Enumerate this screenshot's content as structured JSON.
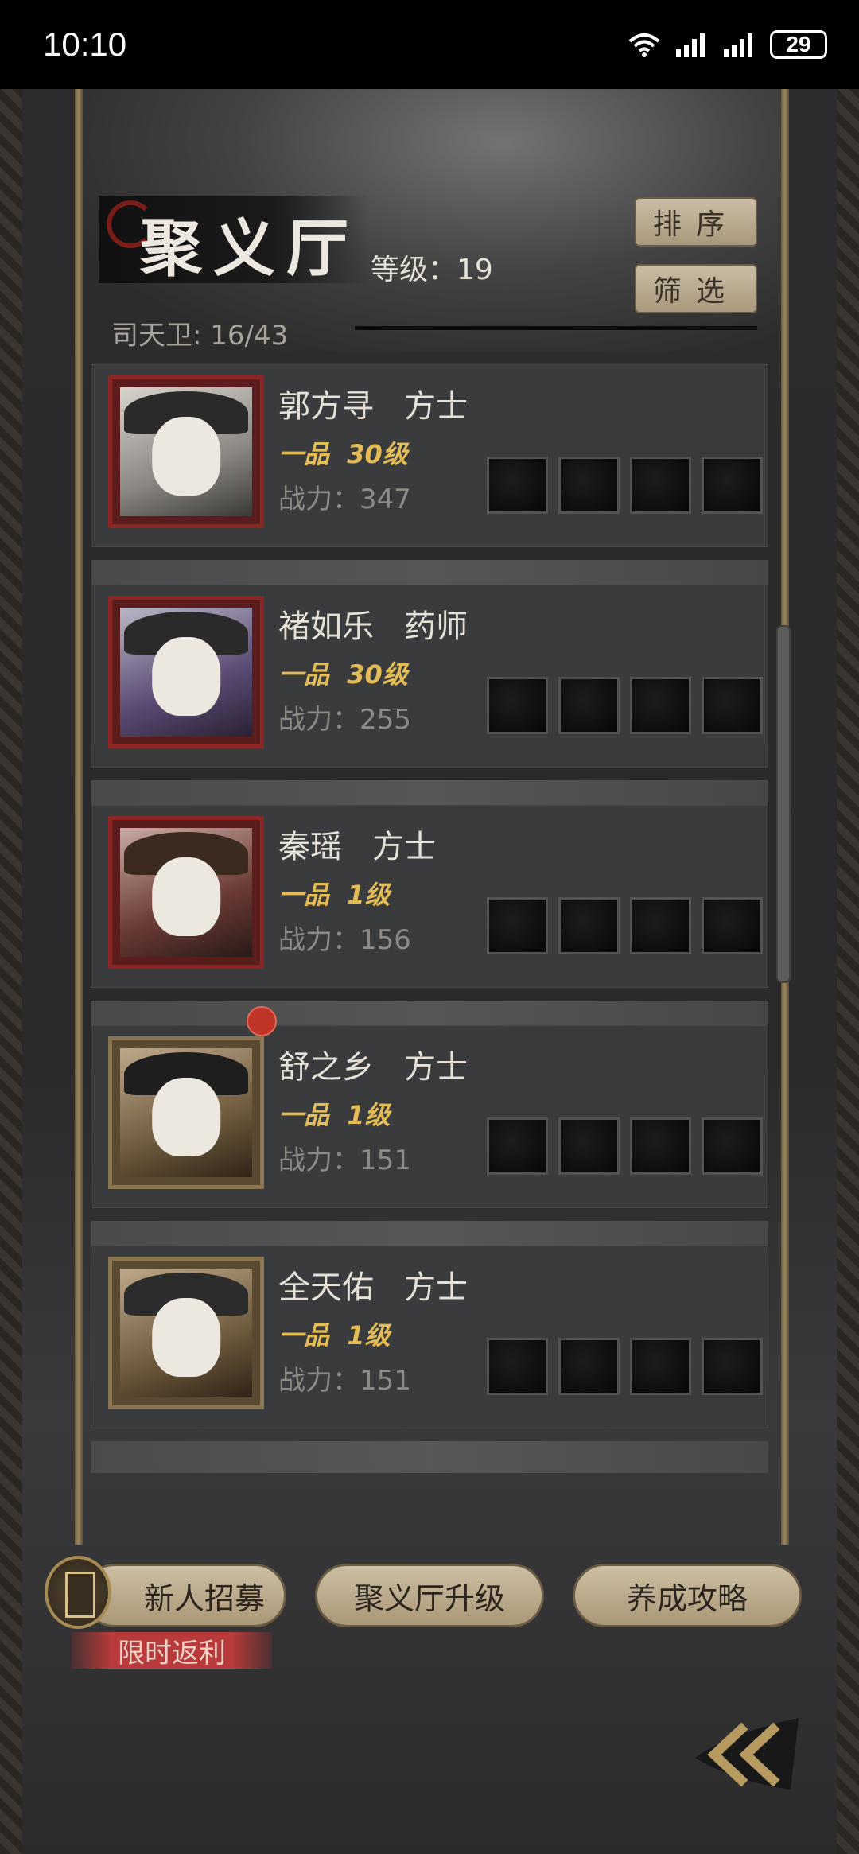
{
  "status_bar": {
    "time": "10:10",
    "battery": "29"
  },
  "header": {
    "title": "聚义厅",
    "level": "等级：19",
    "guards": "司天卫: 16/43",
    "sort_label": "排序",
    "filter_label": "筛选"
  },
  "members": [
    {
      "name": "郭方寻   方士",
      "grade": "一品  30级",
      "power": "战力：347",
      "frame": "red",
      "new": false
    },
    {
      "name": "褚如乐   药师",
      "grade": "一品  30级",
      "power": "战力：255",
      "frame": "red",
      "new": false
    },
    {
      "name": "秦瑶   方士",
      "grade": "一品  1级",
      "power": "战力：156",
      "frame": "red",
      "new": false
    },
    {
      "name": "舒之乡   方士",
      "grade": "一品  1级",
      "power": "战力：151",
      "frame": "gold",
      "new": true
    },
    {
      "name": "全天佑   方士",
      "grade": "一品  1级",
      "power": "战力：151",
      "frame": "gold",
      "new": false
    }
  ],
  "bottom": {
    "recruit_label": "新人招募",
    "upgrade_label": "聚义厅升级",
    "guide_label": "养成攻略",
    "promo_label": "限时返利"
  },
  "colors": {
    "grade_gold": "#e3bc55",
    "frame_red": "#8a2724",
    "frame_gold": "#8a7551",
    "notification_red": "#c0342a"
  },
  "icons": [
    "wifi-icon",
    "signal-icon",
    "back-chevrons-icon",
    "recruit-token-icon"
  ]
}
